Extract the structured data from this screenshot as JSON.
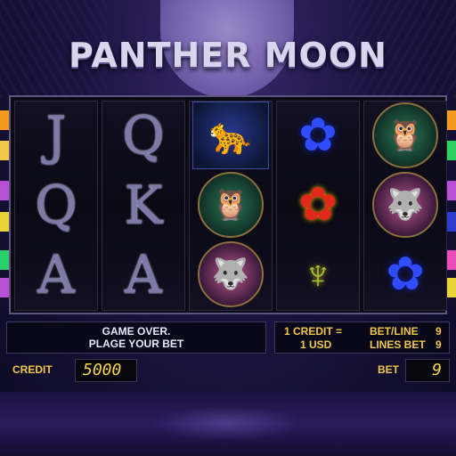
{
  "title": "PANTHER MOON",
  "reels": [
    [
      {
        "kind": "letter",
        "text": "J"
      },
      {
        "kind": "letter",
        "text": "Q"
      },
      {
        "kind": "letter",
        "text": "A"
      }
    ],
    [
      {
        "kind": "letter",
        "text": "Q"
      },
      {
        "kind": "letter",
        "text": "K"
      },
      {
        "kind": "letter",
        "text": "A"
      }
    ],
    [
      {
        "kind": "icon",
        "icon": "panther-icon",
        "glyph": "🐆"
      },
      {
        "kind": "icon",
        "icon": "owl-icon",
        "glyph": "🦉"
      },
      {
        "kind": "icon",
        "icon": "wolf-icon",
        "glyph": "🐺"
      }
    ],
    [
      {
        "kind": "icon",
        "icon": "blue-lotus-icon",
        "glyph": "✿"
      },
      {
        "kind": "icon",
        "icon": "red-lotus-icon",
        "glyph": "✿"
      },
      {
        "kind": "icon",
        "icon": "mask-icon",
        "glyph": "♆"
      }
    ],
    [
      {
        "kind": "icon",
        "icon": "owl-icon",
        "glyph": "🦉"
      },
      {
        "kind": "icon",
        "icon": "wolf-icon",
        "glyph": "🐺"
      },
      {
        "kind": "icon",
        "icon": "blue-lotus-icon",
        "glyph": "✿"
      }
    ]
  ],
  "line_tabs": {
    "left": [
      {
        "color": "#f59a1e"
      },
      {
        "color": "#f2c84a"
      },
      {
        "color": "#b84fd8"
      },
      {
        "color": "#e9d33a"
      },
      {
        "color": "#2bd06a"
      },
      {
        "color": "#b94fd4"
      }
    ],
    "right": [
      {
        "color": "#f59a1e"
      },
      {
        "color": "#2fd05e"
      },
      {
        "color": "#b94fd4"
      },
      {
        "color": "#2b3ccf"
      },
      {
        "color": "#e94fb8"
      },
      {
        "color": "#e9d33a"
      }
    ]
  },
  "message": {
    "line1": "GAME OVER.",
    "line2": "PLAGE YOUR BET"
  },
  "rate": {
    "credit_label": "1 CREDIT =",
    "value": "1 USD"
  },
  "bet_line": {
    "label": "BET/LINE",
    "value": "9"
  },
  "lines_bet": {
    "label": "LINES BET",
    "value": "9"
  },
  "credit": {
    "label": "CREDIT",
    "value": "5000"
  },
  "bet": {
    "label": "BET",
    "value": "9"
  },
  "colors": {
    "accent": "#f2c64a",
    "title": "#d8d6ee",
    "background": "#1b1440"
  }
}
